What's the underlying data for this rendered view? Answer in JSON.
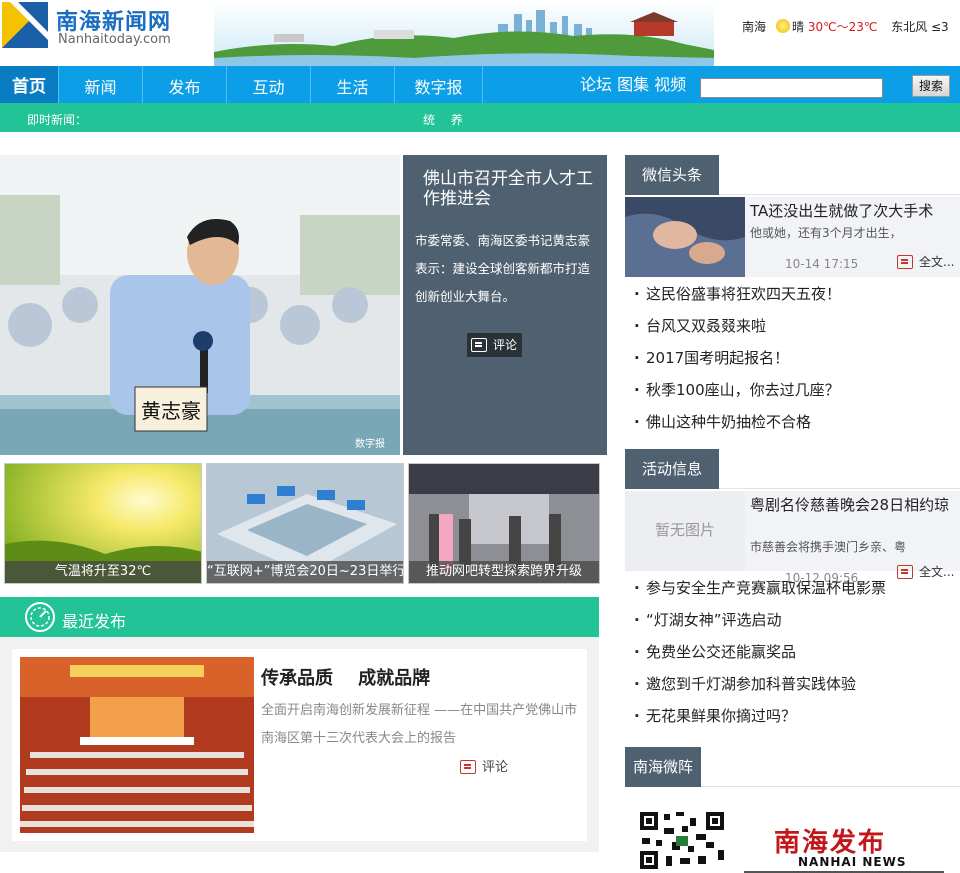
{
  "site": {
    "logo_cn": "南海新闻网",
    "logo_en": "Nanhaitoday.com"
  },
  "weather": {
    "city": "南海",
    "condition": "晴",
    "temp": "30℃～23℃",
    "wind": "东北风 ≤3"
  },
  "nav": {
    "items": [
      "首页",
      "新闻",
      "发布",
      "互动",
      "生活",
      "数字报"
    ],
    "links": "论坛 图集 视频",
    "search_button": "搜索"
  },
  "ticker": {
    "label": "即时新闻：",
    "text": "统 养"
  },
  "hero": {
    "title": "佛山市召开全市人才工作推进会",
    "desc": "市委常委、南海区委书记黄志豪表示：建设全球创客新都市打造创新创业大舞台。",
    "comment": "评论",
    "nameplate": "黄志豪",
    "watermark": "数字报"
  },
  "thumbs": [
    {
      "caption": "气温将升至32℃"
    },
    {
      "caption": "“互联网+”博览会20日~23日举行"
    },
    {
      "caption": "推动网吧转型探索跨界升级"
    }
  ],
  "latest": {
    "section_title": "最近发布",
    "headline": "传承品质    成就品牌",
    "summary": "全面开启南海创新发展新征程 ——在中国共产党佛山市南海区第十三次代表大会上的报告",
    "comment": "评论"
  },
  "wechat": {
    "title": "微信头条",
    "feature": {
      "title": "TA还没出生就做了次大手术",
      "sub": "他或她，还有3个月才出生，",
      "date": "10-14 17:15",
      "more": "全文..."
    },
    "list": [
      "这民俗盛事将狂欢四天五夜！",
      "台风又双叒叕来啦",
      "2017国考明起报名！",
      "秋季100座山，你去过几座？",
      "佛山这种牛奶抽检不合格"
    ]
  },
  "events": {
    "title": "活动信息",
    "feature": {
      "no_image": "暂无图片",
      "title": "粤剧名伶慈善晚会28日相约琼",
      "sub": "市慈善会将携手澳门乡亲、粤",
      "date": "10-12 09:56",
      "more": "全文..."
    },
    "list": [
      "参与安全生产竞赛赢取保温杯电影票",
      "“灯湖女神”评选启动",
      "免费坐公交还能赢奖品",
      "邀您到千灯湖参加科普实践体验",
      "无花果鲜果你摘过吗？"
    ]
  },
  "weizhen": {
    "title": "南海微阵",
    "brand_cn": "南海发布",
    "brand_en": "NANHAI NEWS"
  },
  "colors": {
    "nav_blue": "#0c9ee6",
    "teal": "#21c397",
    "slate": "#4f6170"
  }
}
